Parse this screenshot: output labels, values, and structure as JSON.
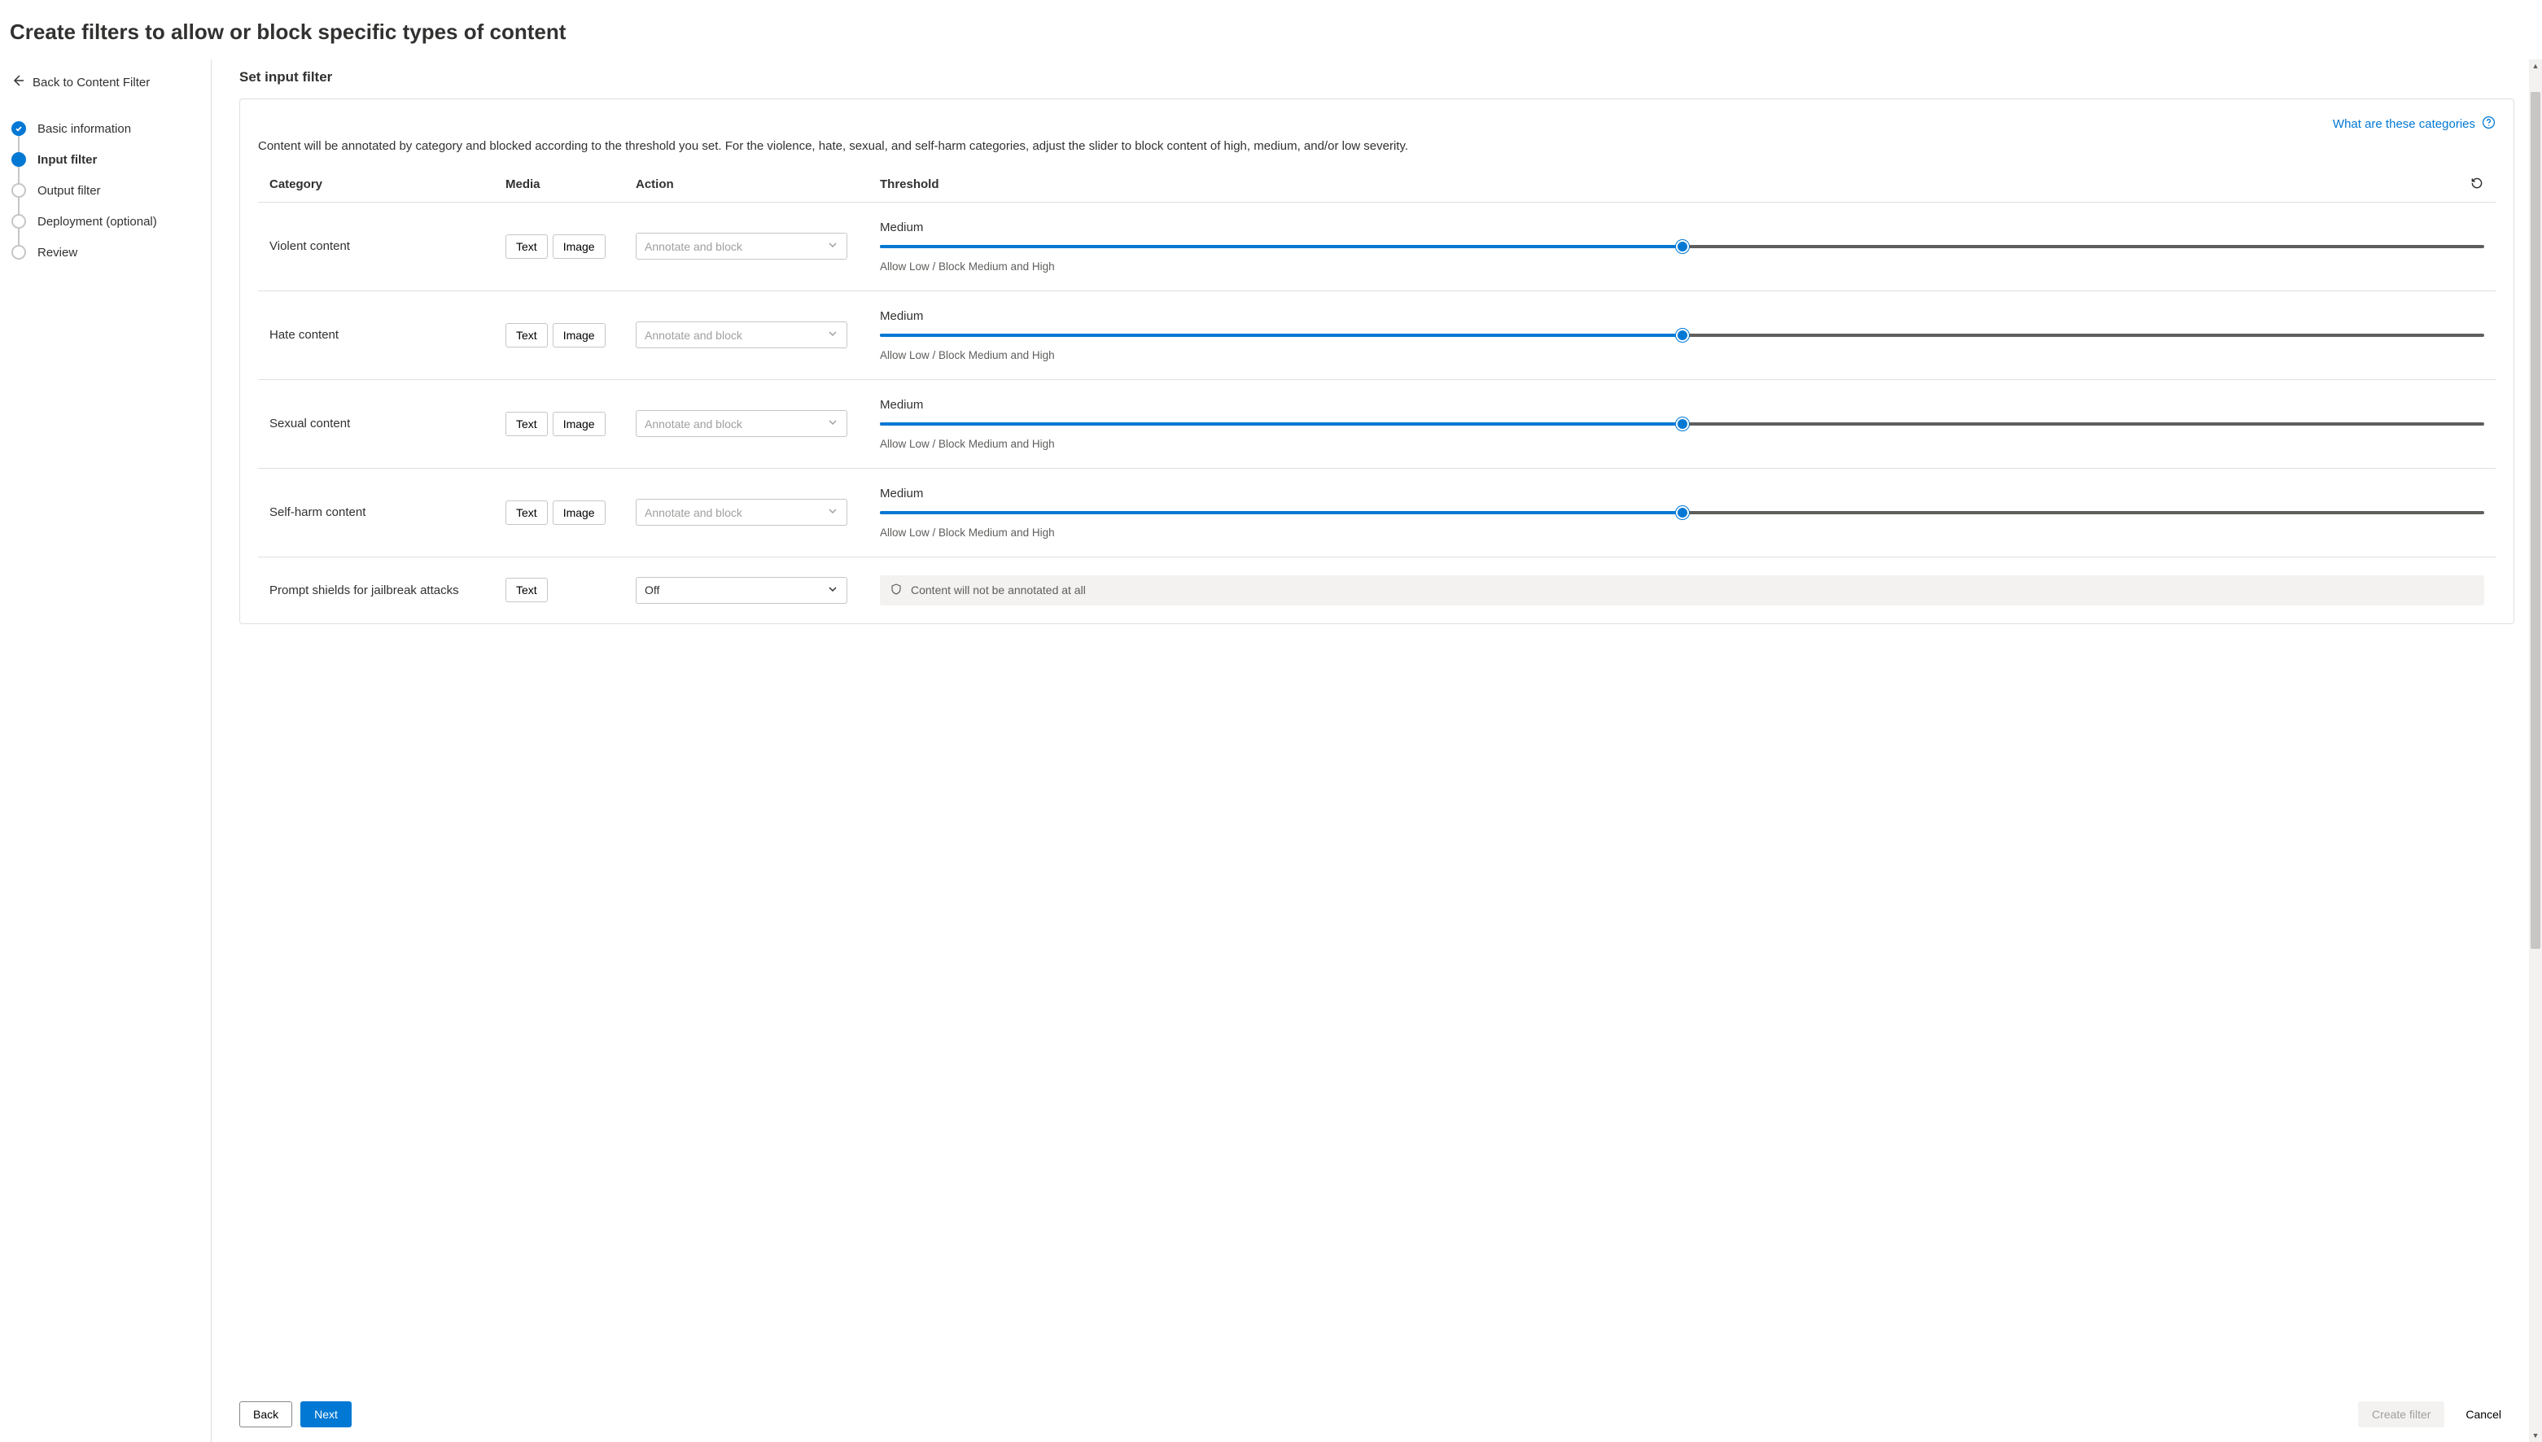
{
  "page_title": "Create filters to allow or block specific types of content",
  "back_link": "Back to Content Filter",
  "steps": [
    {
      "label": "Basic information",
      "state": "completed"
    },
    {
      "label": "Input filter",
      "state": "active"
    },
    {
      "label": "Output filter",
      "state": "pending"
    },
    {
      "label": "Deployment (optional)",
      "state": "pending"
    },
    {
      "label": "Review",
      "state": "pending"
    }
  ],
  "section_title": "Set input filter",
  "help_link_text": "What are these categories",
  "description": "Content will be annotated by category and blocked according to the threshold you set. For the violence, hate, sexual, and self-harm categories, adjust the slider to block content of high, medium, and/or low severity.",
  "columns": {
    "category": "Category",
    "media": "Media",
    "action": "Action",
    "threshold": "Threshold"
  },
  "media_labels": {
    "text": "Text",
    "image": "Image"
  },
  "rows": [
    {
      "category": "Violent content",
      "media": [
        "text",
        "image"
      ],
      "action": "Annotate and block",
      "action_disabled": true,
      "threshold": {
        "label": "Medium",
        "sub": "Allow Low / Block Medium and High",
        "position": 50
      }
    },
    {
      "category": "Hate content",
      "media": [
        "text",
        "image"
      ],
      "action": "Annotate and block",
      "action_disabled": true,
      "threshold": {
        "label": "Medium",
        "sub": "Allow Low / Block Medium and High",
        "position": 50
      }
    },
    {
      "category": "Sexual content",
      "media": [
        "text",
        "image"
      ],
      "action": "Annotate and block",
      "action_disabled": true,
      "threshold": {
        "label": "Medium",
        "sub": "Allow Low / Block Medium and High",
        "position": 50
      }
    },
    {
      "category": "Self-harm content",
      "media": [
        "text",
        "image"
      ],
      "action": "Annotate and block",
      "action_disabled": true,
      "threshold": {
        "label": "Medium",
        "sub": "Allow Low / Block Medium and High",
        "position": 50
      }
    },
    {
      "category": "Prompt shields for jailbreak attacks",
      "media": [
        "text"
      ],
      "action": "Off",
      "action_disabled": false,
      "info": "Content will not be annotated at all"
    }
  ],
  "footer": {
    "back": "Back",
    "next": "Next",
    "create": "Create filter",
    "cancel": "Cancel"
  }
}
